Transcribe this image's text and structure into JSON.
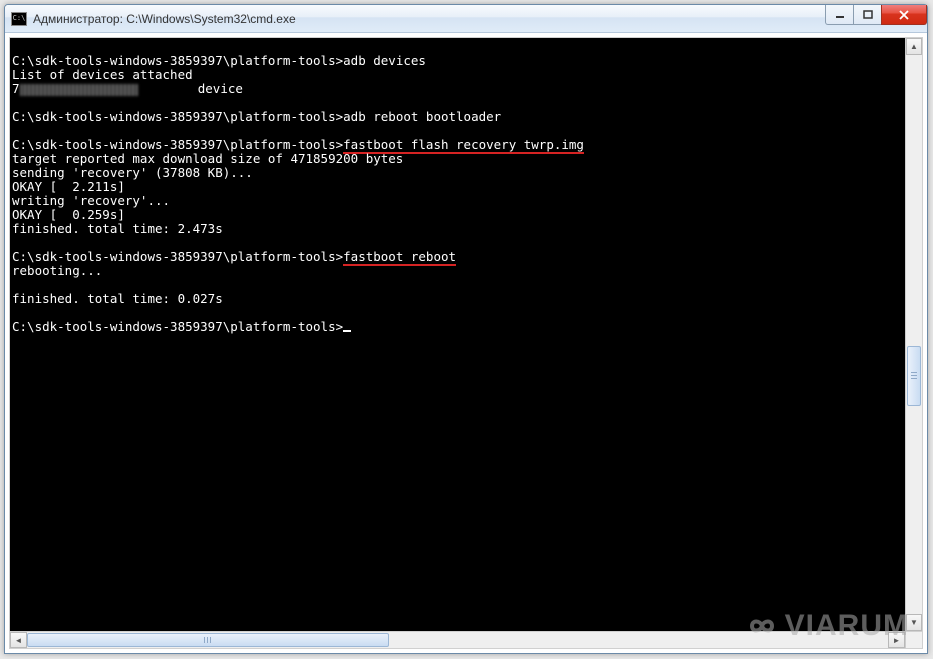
{
  "window": {
    "title": "Администратор: C:\\Windows\\System32\\cmd.exe"
  },
  "terminal": {
    "prompt": "C:\\sdk-tools-windows-3859397\\platform-tools>",
    "cmd_adb_devices": "adb devices",
    "out_list_header": "List of devices attached",
    "out_device_prefix": "7",
    "out_device_suffix": "        device",
    "cmd_reboot_bl": "adb reboot bootloader",
    "cmd_flash": "fastboot flash recovery twrp.img",
    "out_target": "target reported max download size of 471859200 bytes",
    "out_sending": "sending 'recovery' (37808 KB)...",
    "out_okay1": "OKAY [  2.211s]",
    "out_writing": "writing 'recovery'...",
    "out_okay2": "OKAY [  0.259s]",
    "out_finished1": "finished. total time: 2.473s",
    "cmd_reboot": "fastboot reboot",
    "out_rebooting": "rebooting...",
    "out_finished2": "finished. total time: 0.027s"
  },
  "watermark": {
    "text": "VIARUM"
  }
}
